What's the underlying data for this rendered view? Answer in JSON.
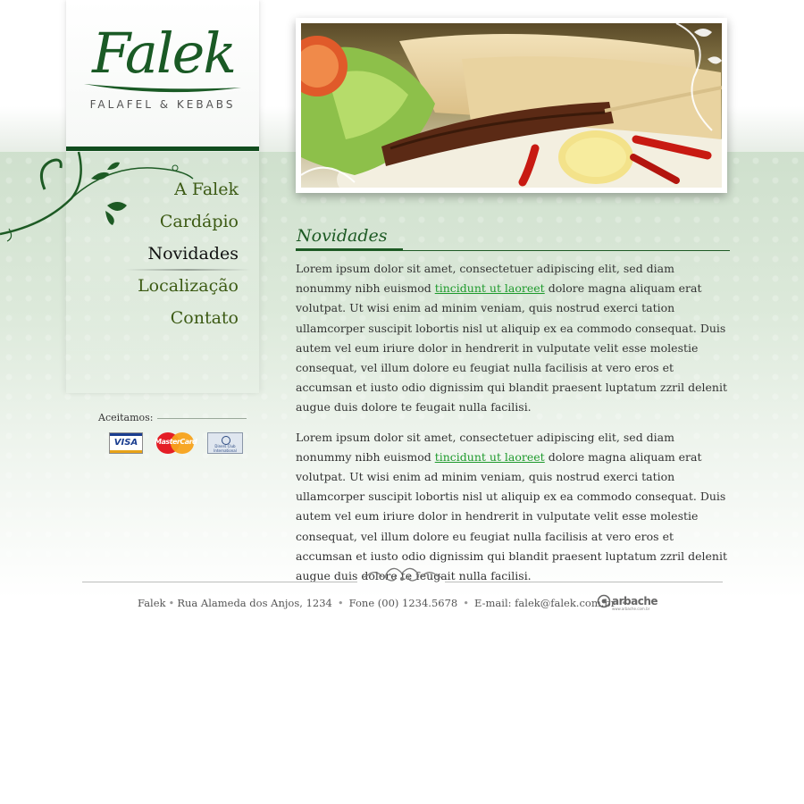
{
  "brand": {
    "logo_name": "Falek",
    "tagline": "FALAFEL & KEBABS"
  },
  "nav": {
    "items": [
      {
        "label": "A Falek",
        "active": false
      },
      {
        "label": "Cardápio",
        "active": false
      },
      {
        "label": "Novidades",
        "active": true
      },
      {
        "label": "Localização",
        "active": false
      },
      {
        "label": "Contato",
        "active": false
      }
    ]
  },
  "payments": {
    "label": "Aceitamos:",
    "cards": [
      "VISA",
      "MasterCard",
      "Diners Club International"
    ]
  },
  "main": {
    "section_title": "Novidades",
    "paragraphs": [
      {
        "before": "Lorem ipsum dolor sit amet, consectetuer adipiscing elit, sed diam nonummy nibh euismod ",
        "link": "tincidunt ut laoreet",
        "after": " dolore magna aliquam erat volutpat. Ut wisi enim ad minim veniam, quis nostrud exerci tation ullamcorper suscipit lobortis nisl ut aliquip ex ea commodo consequat. Duis autem vel eum iriure dolor in hendrerit in vulputate velit esse molestie consequat, vel illum dolore eu feugiat nulla facilisis at vero eros et accumsan et iusto odio dignissim qui blandit praesent luptatum zzril delenit augue duis dolore te feugait nulla facilisi."
      },
      {
        "before": "Lorem ipsum dolor sit amet, consectetuer adipiscing elit, sed diam nonummy nibh euismod ",
        "link": "tincidunt ut laoreet",
        "after": " dolore magna aliquam erat volutpat. Ut wisi enim ad minim veniam, quis nostrud exerci tation ullamcorper suscipit lobortis nisl ut aliquip ex ea commodo consequat. Duis autem vel eum iriure dolor in hendrerit in vulputate velit esse molestie consequat, vel illum dolore eu feugiat nulla facilisis at vero eros et accumsan et iusto odio dignissim qui blandit praesent luptatum zzril delenit augue duis dolore te feugait nulla facilisi."
      }
    ]
  },
  "footer": {
    "name": "Falek",
    "address": "Rua Alameda dos Anjos, 1234",
    "phone": "Fone (00) 1234.5678",
    "email": "E-mail: falek@falek.com.br",
    "credit": "arbache",
    "credit_url": "www.arbache.com.br"
  },
  "colors": {
    "brand_green": "#1d5a24",
    "nav_text": "#3c5a14",
    "link": "#1e9a2c"
  }
}
